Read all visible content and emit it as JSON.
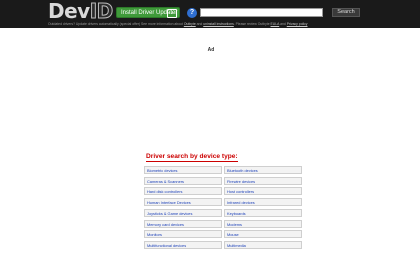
{
  "header": {
    "logo_dev": "Dev",
    "logo_id": "ID",
    "install_label": "Install Driver Updater",
    "search_placeholder": "",
    "search_label": "Search",
    "subline_prefix": "Outdated drivers? Update drivers automatically (special offer) See more information about ",
    "subline_link1": "Outbyte",
    "subline_mid": " and ",
    "subline_link2": "uninstall instructions",
    "subline_mid2": ". Please review Outbyte ",
    "subline_link3": "EULA",
    "subline_and": " and ",
    "subline_link4": "Privacy policy"
  },
  "ad": {
    "label": "Ad"
  },
  "drivers": {
    "title": "Driver search by device type:",
    "left": [
      "Biometric devices",
      "Cameras & Scanners",
      "Hard disk controllers",
      "Human Interface Devices",
      "Joysticks & Game devices",
      "Memory card devices",
      "Monitors",
      "Multifunctional devices"
    ],
    "right": [
      "Bluetooth devices",
      "Firewire devices",
      "Host controllers",
      "Infrared devices",
      "Keyboards",
      "Modems",
      "Mouse",
      "Multimedia"
    ]
  }
}
